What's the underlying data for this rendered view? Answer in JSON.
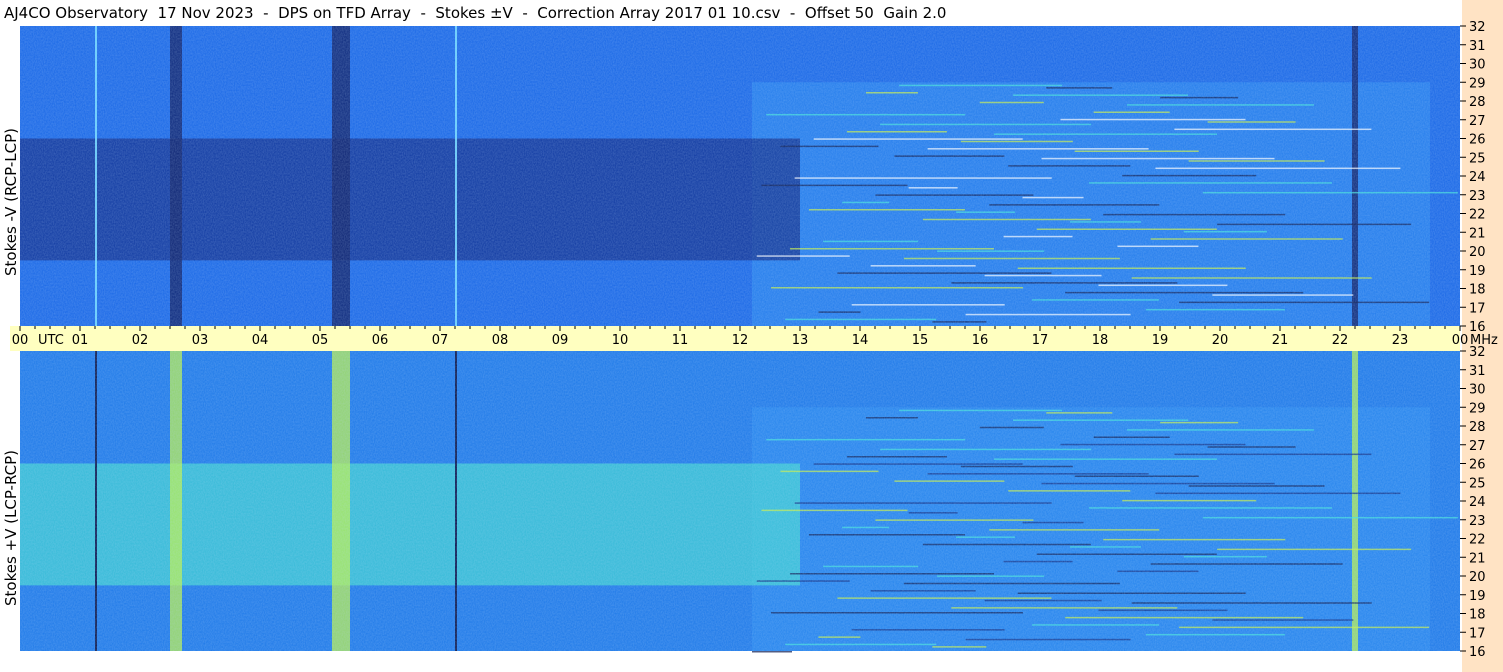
{
  "title": "AJ4CO Observatory  17 Nov 2023  -  DPS on TFD Array  -  Stokes ±V  -  Correction Array 2017 01 10.csv  -  Offset 50  Gain 2.0",
  "colors": {
    "background": "#ffffff",
    "time_axis_band": "#ffffc0",
    "right_strip": "#ffe3c4",
    "colormap": [
      "#081850",
      "#0b3aa8",
      "#1766e6",
      "#2a9af0",
      "#3fe0d8",
      "#c8f040",
      "#ffffff"
    ]
  },
  "chart_data": [
    {
      "type": "heatmap",
      "title": "",
      "ylabel": "Stokes -V (RCP-LCP)",
      "xlabel": "",
      "x_ticks": [
        "00",
        "01",
        "02",
        "03",
        "04",
        "05",
        "06",
        "07",
        "08",
        "09",
        "10",
        "11",
        "12",
        "13",
        "14",
        "15",
        "16",
        "17",
        "18",
        "19",
        "20",
        "21",
        "22",
        "23",
        "00"
      ],
      "x_unit_left": "UTC",
      "xlim_hours": [
        0,
        24
      ],
      "y_ticks": [
        32,
        31,
        30,
        29,
        28,
        27,
        26,
        25,
        24,
        23,
        22,
        21,
        20,
        19,
        18,
        17,
        16
      ],
      "y_unit": "MHz",
      "ylim_mhz": [
        16,
        32
      ],
      "features": [
        {
          "kind": "dark_vertical_band",
          "hours": [
            2.5,
            2.7
          ]
        },
        {
          "kind": "dark_vertical_band",
          "hours": [
            5.2,
            5.5
          ]
        },
        {
          "kind": "dark_vertical_band",
          "hours": [
            22.2,
            22.3
          ]
        },
        {
          "kind": "dark_region",
          "hours": [
            0,
            13.0
          ],
          "mhz": [
            19.5,
            26
          ]
        },
        {
          "kind": "bright_vertical_line",
          "hours": [
            1.25,
            1.28
          ]
        },
        {
          "kind": "bright_vertical_line",
          "hours": [
            7.25,
            7.28
          ]
        },
        {
          "kind": "rfi_region",
          "hours": [
            12.2,
            23.5
          ],
          "mhz": [
            16,
            29
          ]
        }
      ]
    },
    {
      "type": "heatmap",
      "title": "",
      "ylabel": "Stokes +V (LCP-RCP)",
      "xlabel": "",
      "xlim_hours": [
        0,
        24
      ],
      "y_ticks": [
        32,
        31,
        30,
        29,
        28,
        27,
        26,
        25,
        24,
        23,
        22,
        21,
        20,
        19,
        18,
        17,
        16
      ],
      "ylim_mhz": [
        16,
        32
      ],
      "features": [
        {
          "kind": "bright_vertical_band",
          "hours": [
            2.5,
            2.7
          ]
        },
        {
          "kind": "bright_vertical_band",
          "hours": [
            5.2,
            5.5
          ]
        },
        {
          "kind": "bright_vertical_band",
          "hours": [
            22.2,
            22.3
          ]
        },
        {
          "kind": "bright_region",
          "hours": [
            0,
            13.0
          ],
          "mhz": [
            19.5,
            26
          ]
        },
        {
          "kind": "dark_vertical_line",
          "hours": [
            1.25,
            1.28
          ]
        },
        {
          "kind": "dark_vertical_line",
          "hours": [
            7.25,
            7.28
          ]
        },
        {
          "kind": "rfi_region",
          "hours": [
            12.2,
            23.5
          ],
          "mhz": [
            16,
            29
          ]
        }
      ]
    }
  ]
}
